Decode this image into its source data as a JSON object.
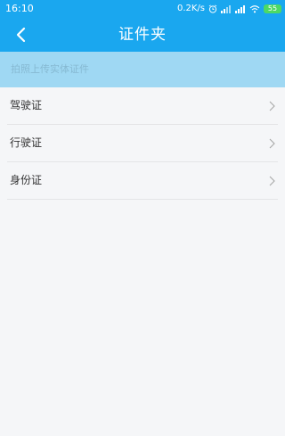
{
  "status_bar": {
    "time": "16:10",
    "speed": "0.2K/s",
    "battery": "55",
    "icons": [
      "alarm-icon",
      "signal-icon",
      "signal-icon",
      "wifi-icon",
      "battery-icon"
    ]
  },
  "nav": {
    "title": "证件夹",
    "back_icon": "back-arrow-icon"
  },
  "banner": {
    "text": "拍照上传实体证件"
  },
  "list": {
    "items": [
      {
        "label": "驾驶证",
        "icon": "chevron-right-icon"
      },
      {
        "label": "行驶证",
        "icon": "chevron-right-icon"
      },
      {
        "label": "身份证",
        "icon": "chevron-right-icon"
      }
    ]
  },
  "colors": {
    "primary": "#1aa7ef",
    "banner_bg": "#9fd8f3",
    "banner_text": "#86b9d2",
    "page_bg": "#f5f6f8",
    "battery": "#4cd964"
  }
}
